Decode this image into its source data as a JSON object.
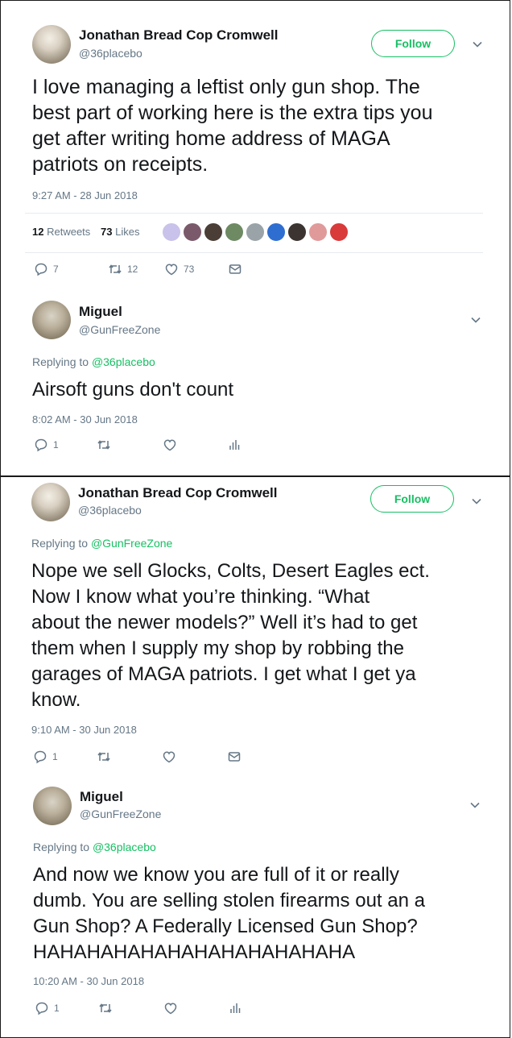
{
  "tweets": [
    {
      "name": "Jonathan Bread Cop Cromwell",
      "handle": "@36placebo",
      "follow_label": "Follow",
      "text": "I love managing a leftist only gun shop. The\nbest part of working here is the extra tips you\nget after writing home address of MAGA\npatriots on receipts.",
      "time": "9:27 AM - 28 Jun 2018",
      "retweets_count": "12",
      "retweets_label": "Retweets",
      "likes_count": "73",
      "likes_label": "Likes",
      "actions": {
        "reply": "7",
        "retweet": "12",
        "like": "73"
      }
    },
    {
      "name": "Miguel",
      "handle": "@GunFreeZone",
      "replying_prefix": "Replying to",
      "replying_to": "@36placebo",
      "text": "Airsoft guns don't count",
      "time": "8:02 AM - 30 Jun 2018",
      "actions": {
        "reply": "1"
      }
    },
    {
      "name": "Jonathan Bread Cop Cromwell",
      "handle": "@36placebo",
      "follow_label": "Follow",
      "replying_prefix": "Replying to",
      "replying_to": "@GunFreeZone",
      "text": "Nope we sell Glocks, Colts, Desert Eagles ect.\nNow I know what you’re thinking. “What\nabout the newer models?” Well it’s had to get\nthem when I supply my shop by robbing the\ngarages of MAGA patriots. I get what I get ya\nknow.",
      "time": "9:10 AM - 30 Jun 2018",
      "actions": {
        "reply": "1"
      }
    },
    {
      "name": "Miguel",
      "handle": "@GunFreeZone",
      "replying_prefix": "Replying to",
      "replying_to": "@36placebo",
      "text": "And now we know you are full of it or really\ndumb. You are selling stolen firearms out an a\nGun Shop? A Federally Licensed Gun Shop?\nHAHAHAHAHAHAHAHAHAHAHAHA",
      "time": "10:20 AM - 30 Jun 2018",
      "actions": {
        "reply": "1"
      }
    }
  ],
  "colors": {
    "accent": "#17bf63",
    "muted": "#657786",
    "text": "#14171a",
    "border": "#e6ecf0"
  },
  "icons": [
    "reply-icon",
    "retweet-icon",
    "like-icon",
    "message-icon",
    "analytics-icon",
    "chevron-down-icon"
  ]
}
